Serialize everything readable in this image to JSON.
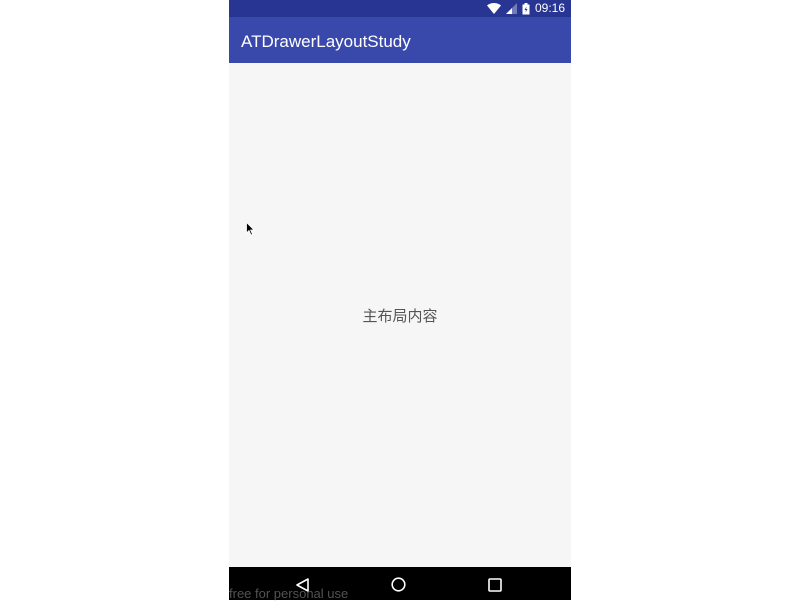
{
  "status_bar": {
    "time": "09:16",
    "icons": [
      "wifi-icon",
      "signal-icon",
      "battery-icon"
    ],
    "background": "#283593"
  },
  "app_bar": {
    "title": "ATDrawerLayoutStudy",
    "background": "#3949ab"
  },
  "main": {
    "content_text": "主布局内容"
  },
  "nav_bar": {
    "buttons": [
      "back-icon",
      "home-icon",
      "recents-icon"
    ]
  },
  "watermark": {
    "text": "free for personal use"
  }
}
